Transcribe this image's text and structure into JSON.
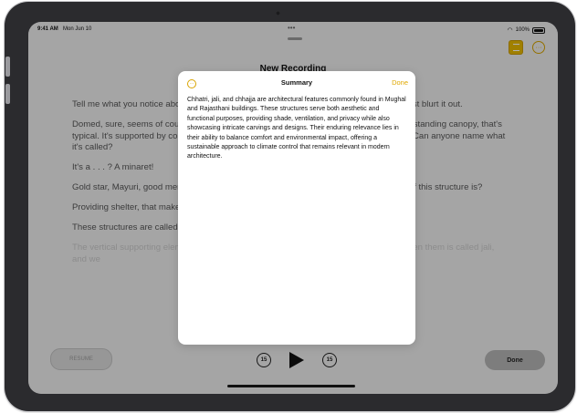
{
  "status_bar": {
    "time": "9:41 AM",
    "date": "Mon Jun 10",
    "battery": "100%"
  },
  "recording": {
    "title": "New Recording",
    "transcript": [
      "Tell me what you notice about this image. Yes, go ahead. No need to raise your hand, just blurt it out.",
      "Domed, sure, seems of course, you'd notice that first. And you've looked at, right? A freestanding canopy, that's typical. It's supported by columns on a platform of fine carvings. Pointy thing on the top, Can anyone name what it's called?",
      "It's a . . . ? A minaret!",
      "Gold star, Mayuri, good memory. Now what do you think, can you imagine the purpose of this structure is?",
      "Providing shelter, that makes sense, but shade and a view, you're absolutely correct.",
      "These structures are called chhatris.",
      "The vertical supporting elements are columns, and the decorative screen that sits between them is called jali, and we"
    ]
  },
  "summary_modal": {
    "title": "Summary",
    "done_label": "Done",
    "text": "Chhatri, jali, and chhajja are architectural features commonly found in Mughal and Rajasthani buildings. These structures serve both aesthetic and functional purposes, providing shade, ventilation, and privacy while also showcasing intricate carvings and designs. Their enduring relevance lies in their ability to balance comfort and environmental impact, offering a sustainable approach to climate control that remains relevant in modern architecture."
  },
  "controls": {
    "resume_label": "RESUME",
    "skip_back_label": "15",
    "skip_forward_label": "15",
    "done_label": "Done"
  },
  "colors": {
    "accent": "#e0a800",
    "dim_overlay": "rgba(0,0,0,0.30)"
  },
  "icons": {
    "summary": "summary-icon",
    "more": "ellipsis-circle-icon",
    "play": "play-icon",
    "skip_back": "gobackward-15-icon",
    "skip_forward": "goforward-15-icon"
  }
}
